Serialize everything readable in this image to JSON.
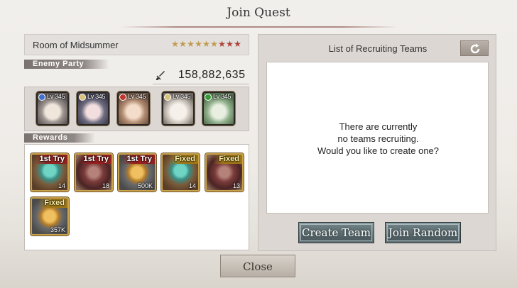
{
  "dialog": {
    "title": "Join Quest"
  },
  "quest": {
    "name": "Room of Midsummer",
    "stars_total": 9,
    "stars_filled": 9,
    "star_colors": [
      "#c19a4e",
      "#c19a4e",
      "#c19a4e",
      "#c19a4e",
      "#c19a4e",
      "#c19a4e",
      "#b0413a",
      "#b0413a",
      "#b0413a"
    ]
  },
  "enemy_party": {
    "label": "Enemy Party",
    "power": "158,882,635",
    "icon": "sword-icon",
    "enemies": [
      {
        "level": "Lv 345",
        "element_color": "#3f6fd0"
      },
      {
        "level": "Lv 345",
        "element_color": "#d9c37a"
      },
      {
        "level": "Lv 345",
        "element_color": "#c0352d"
      },
      {
        "level": "Lv 345",
        "element_color": "#d9c37a"
      },
      {
        "level": "Lv 345",
        "element_color": "#3a9a3a"
      }
    ]
  },
  "rewards": {
    "label": "Rewards",
    "items": [
      {
        "tag": "1st Try",
        "qty": "14",
        "kind": "potion"
      },
      {
        "tag": "1st Try",
        "qty": "18",
        "kind": "chest"
      },
      {
        "tag": "1st Try",
        "qty": "500K",
        "kind": "coin"
      },
      {
        "tag": "Fixed",
        "qty": "14",
        "kind": "potion"
      },
      {
        "tag": "Fixed",
        "qty": "13",
        "kind": "chest"
      },
      {
        "tag": "Fixed",
        "qty": "357K",
        "kind": "coin"
      }
    ]
  },
  "recruiting": {
    "title": "List of Recruiting Teams",
    "refresh_icon": "refresh-icon",
    "empty_lines": [
      "There are currently",
      "no teams recruiting.",
      "Would you like to create one?"
    ],
    "create_label": "Create Team",
    "join_label": "Join Random"
  },
  "footer": {
    "close_label": "Close"
  }
}
